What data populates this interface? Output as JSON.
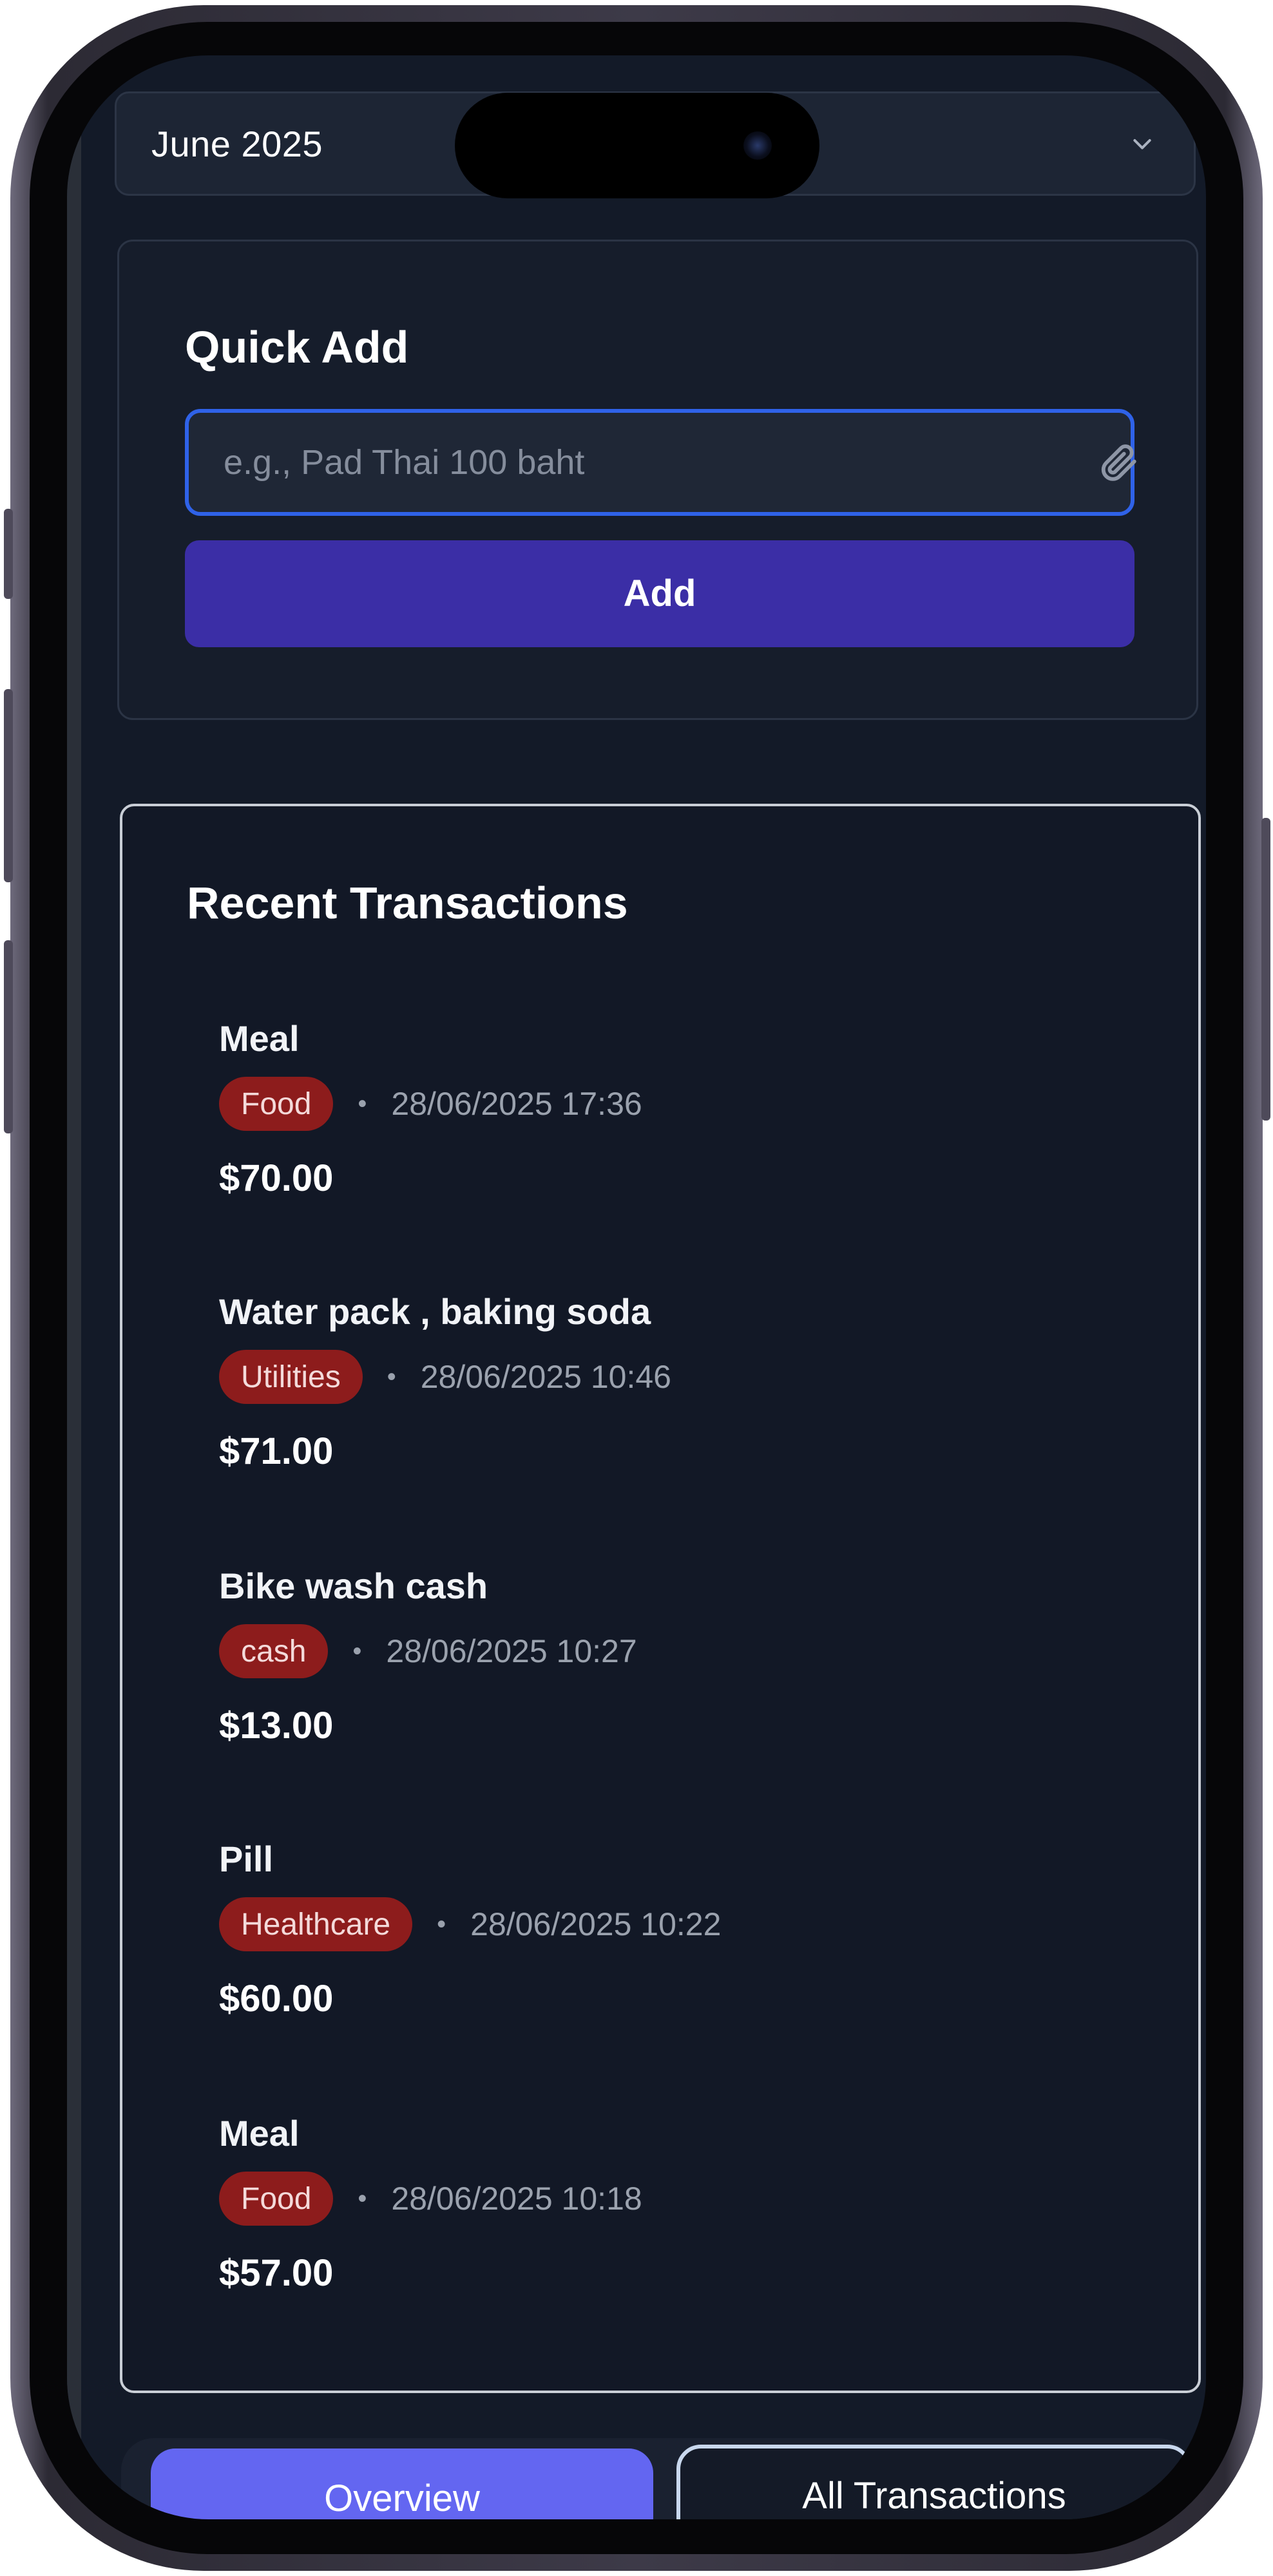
{
  "month_selector": {
    "label": "June 2025",
    "icon": "chevron-down-icon"
  },
  "quick_add": {
    "title": "Quick Add",
    "input_placeholder": "e.g., Pad Thai 100 baht",
    "input_value": "",
    "attach_icon": "paperclip-icon",
    "add_label": "Add"
  },
  "recent": {
    "title": "Recent Transactions",
    "items": [
      {
        "name": "Meal",
        "category": "Food",
        "date": "28/06/2025 17:36",
        "amount": "$70.00"
      },
      {
        "name": "Water pack , baking soda",
        "category": "Utilities",
        "date": "28/06/2025 10:46",
        "amount": "$71.00"
      },
      {
        "name": "Bike wash cash",
        "category": "cash",
        "date": "28/06/2025 10:27",
        "amount": "$13.00"
      },
      {
        "name": "Pill",
        "category": "Healthcare",
        "date": "28/06/2025 10:22",
        "amount": "$60.00"
      },
      {
        "name": "Meal",
        "category": "Food",
        "date": "28/06/2025 10:18",
        "amount": "$57.00"
      }
    ],
    "separator": "•"
  },
  "bottom_nav": {
    "overview_label": "Overview",
    "all_transactions_label": "All Transactions",
    "active": "Overview"
  },
  "colors": {
    "background": "#131a28",
    "card": "#161d2b",
    "primary_button": "#3b2ea6",
    "badge": "#8d1c1c",
    "active_tab": "#6366f1",
    "input_border": "#2f62e8"
  }
}
